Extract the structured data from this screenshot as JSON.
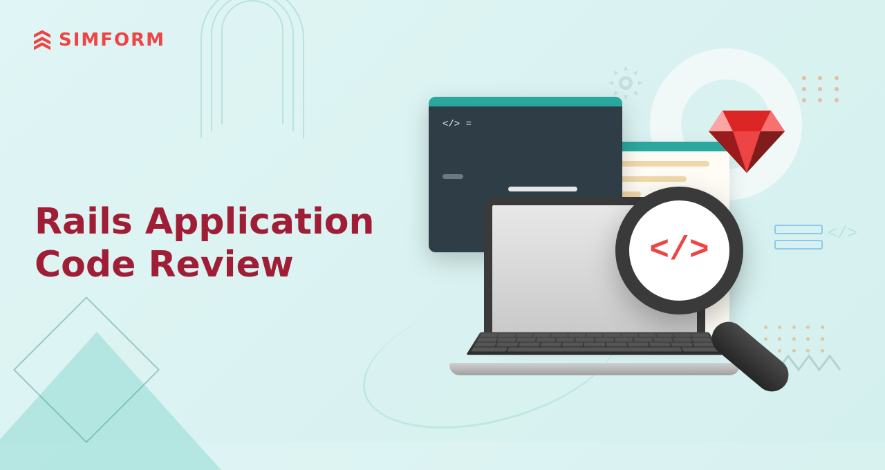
{
  "logo": {
    "text": "SIMFORM"
  },
  "headline": {
    "line1": "Rails Application",
    "line2": "Code Review"
  },
  "code_window": {
    "tag": "</> ="
  },
  "magnifier": {
    "symbol": "</>"
  }
}
